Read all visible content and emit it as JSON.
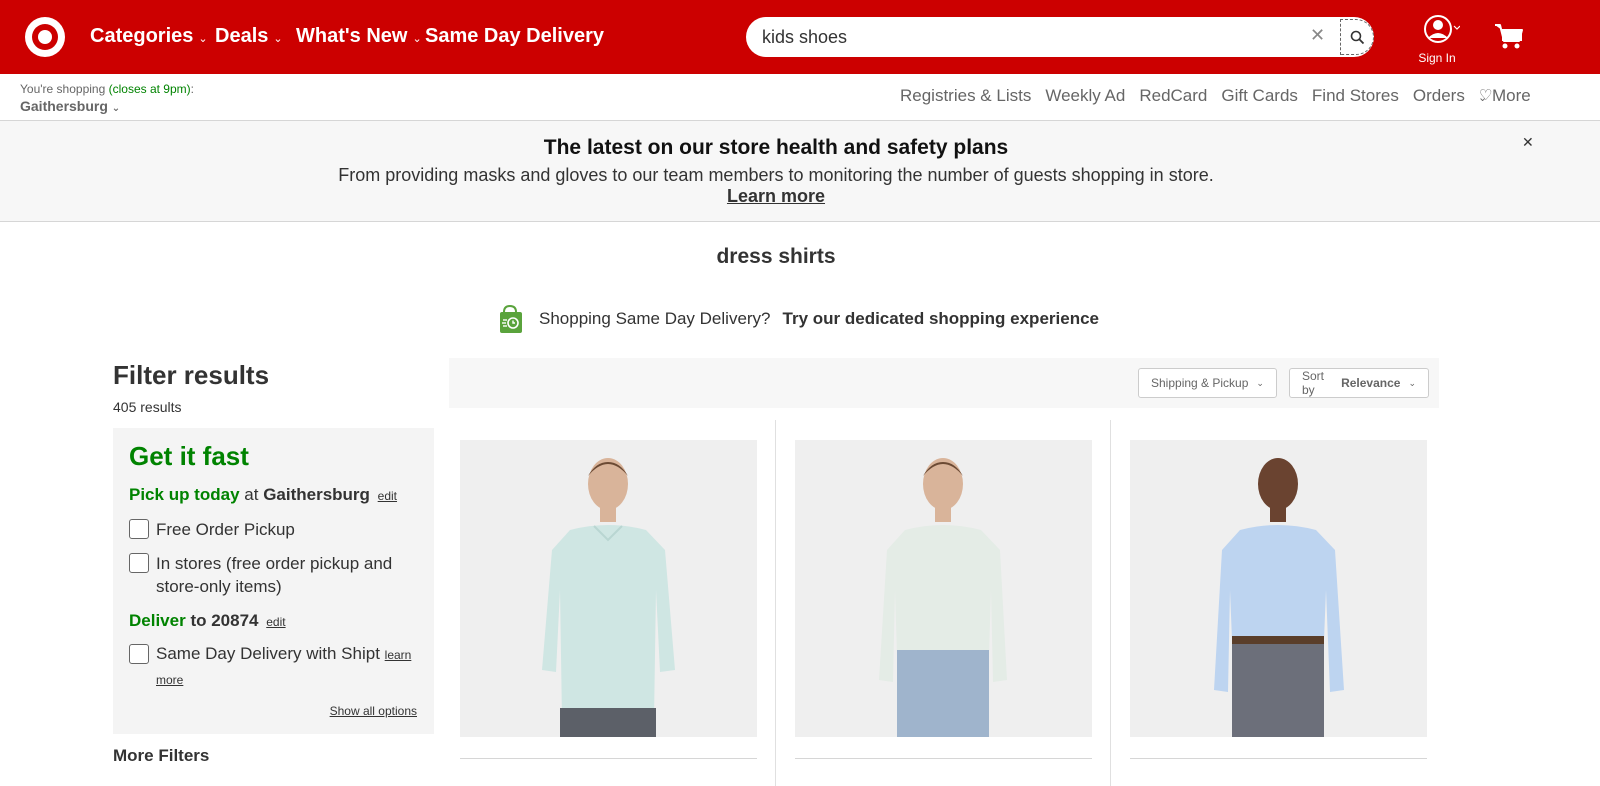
{
  "header": {
    "nav": [
      {
        "label": "Categories",
        "has_menu": true
      },
      {
        "label": "Deals",
        "has_menu": true
      },
      {
        "label": "What's New",
        "has_menu": true
      },
      {
        "label": "Same Day Delivery",
        "has_menu": false
      }
    ],
    "search_value": "kids shoes",
    "sign_in_label": "Sign In",
    "brand_color": "#cc0000"
  },
  "subheader": {
    "shopping_prefix": "You're shopping",
    "closes": "(closes at 9pm)",
    "colon": ":",
    "store_name": "Gaithersburg",
    "links": [
      "Registries & Lists",
      "Weekly Ad",
      "RedCard",
      "Gift Cards",
      "Find Stores",
      "Orders"
    ],
    "more_label": "More"
  },
  "banner": {
    "title": "The latest on our store health and safety plans",
    "description": "From providing masks and gloves to our team members to monitoring the number of guests shopping in store.",
    "link": "Learn more"
  },
  "page_title": "dress shirts",
  "same_day": {
    "question": "Shopping Same Day Delivery?",
    "cta": "Try our dedicated shopping experience"
  },
  "filters": {
    "title": "Filter results",
    "results_count": "405 results",
    "get_it_fast": "Get it fast",
    "pickup_prefix": "Pick up today",
    "pickup_at": "at",
    "pickup_store": "Gaithersburg",
    "edit_label": "edit",
    "options_pickup": [
      {
        "label": "Free Order Pickup",
        "checked": false
      },
      {
        "label": "In stores (free order pickup and store-only items)",
        "checked": false
      }
    ],
    "deliver_prefix": "Deliver",
    "deliver_to": "to",
    "deliver_zip": "20874",
    "shipt_label": "Same Day Delivery with Shipt",
    "learn_more": "learn more",
    "show_all": "Show all options",
    "more_filters": "More Filters"
  },
  "toolbar": {
    "shipping_label": "Shipping & Pickup",
    "sort_prefix": "Sort by",
    "sort_value": "Relevance"
  },
  "products": [
    {
      "shirt_color": "#cfe6e3"
    },
    {
      "shirt_color": "#e4ece6"
    },
    {
      "shirt_color": "#bdd4f0"
    }
  ]
}
